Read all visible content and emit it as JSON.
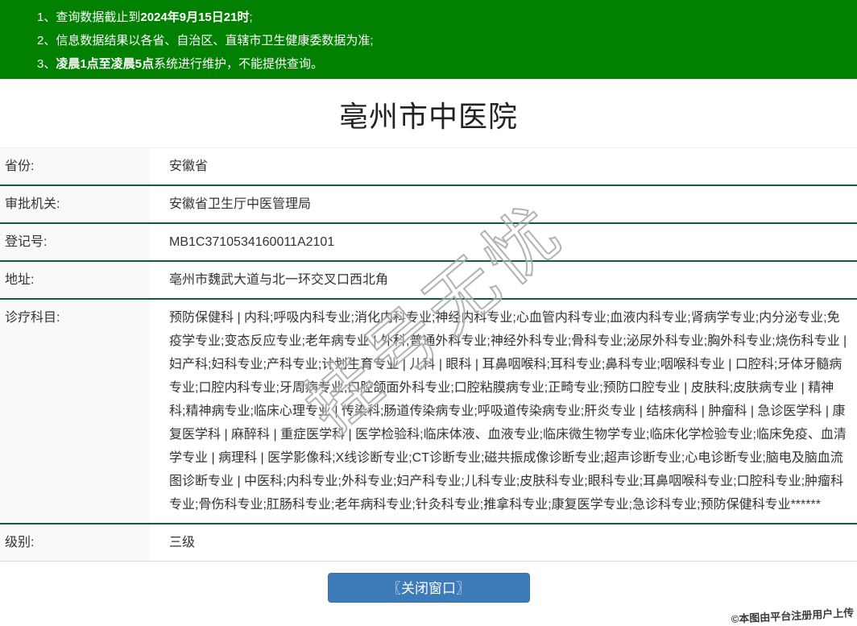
{
  "banner": {
    "background_color": "#028002",
    "text_color": "#ffffff",
    "notices": [
      {
        "num": "1、",
        "pre": "查询数据截止到",
        "bold": "2024年9月15日21时",
        "post": ";"
      },
      {
        "num": "2、",
        "pre": "信息数据结果以各省、自治区、直辖市卫生健康委数据为准;",
        "bold": "",
        "post": ""
      },
      {
        "num": "3、",
        "pre": "",
        "bold": "凌晨1点至凌晨5点",
        "post": "系统进行维护，不能提供查询。"
      }
    ]
  },
  "title": "亳州市中医院",
  "table": {
    "divider_color": "#0c6135",
    "label_bg_color": "#f9f9f9",
    "rows": [
      {
        "label": "省份:",
        "value": "安徽省"
      },
      {
        "label": "审批机关:",
        "value": "安徽省卫生厅中医管理局"
      },
      {
        "label": "登记号:",
        "value": "MB1C3710534160011A2101"
      },
      {
        "label": "地址:",
        "value": "亳州市魏武大道与北一环交叉口西北角"
      },
      {
        "label": "诊疗科目:",
        "value": "预防保健科 | 内科;呼吸内科专业;消化内科专业;神经内科专业;心血管内科专业;血液内科专业;肾病学专业;内分泌专业;免疫学专业;变态反应专业;老年病专业 | 外科;普通外科专业;神经外科专业;骨科专业;泌尿外科专业;胸外科专业;烧伤科专业 | 妇产科;妇科专业;产科专业;计划生育专业 | 儿科 | 眼科 | 耳鼻咽喉科;耳科专业;鼻科专业;咽喉科专业 | 口腔科;牙体牙髓病专业;口腔内科专业;牙周病专业;口腔颌面外科专业;口腔粘膜病专业;正畸专业;预防口腔专业 | 皮肤科;皮肤病专业 | 精神科;精神病专业;临床心理专业 | 传染科;肠道传染病专业;呼吸道传染病专业;肝炎专业 | 结核病科 | 肿瘤科 | 急诊医学科 | 康复医学科 | 麻醉科 | 重症医学科 | 医学检验科;临床体液、血液专业;临床微生物学专业;临床化学检验专业;临床免疫、血清学专业 | 病理科 | 医学影像科;X线诊断专业;CT诊断专业;磁共振成像诊断专业;超声诊断专业;心电诊断专业;脑电及脑血流图诊断专业 | 中医科;内科专业;外科专业;妇产科专业;儿科专业;皮肤科专业;眼科专业;耳鼻咽喉科专业;口腔科专业;肿瘤科专业;骨伤科专业;肛肠科专业;老年病科专业;针灸科专业;推拿科专业;康复医学专业;急诊科专业;预防保健科专业******"
      },
      {
        "label": "级别:",
        "value": "三级"
      }
    ]
  },
  "footer": {
    "close_button_label": "〖关闭窗口〗",
    "button_color": "#3d7cb8"
  },
  "watermarks": {
    "center_text": "挂号无忧",
    "corner_text": "©本图由平台注册用户上传"
  }
}
